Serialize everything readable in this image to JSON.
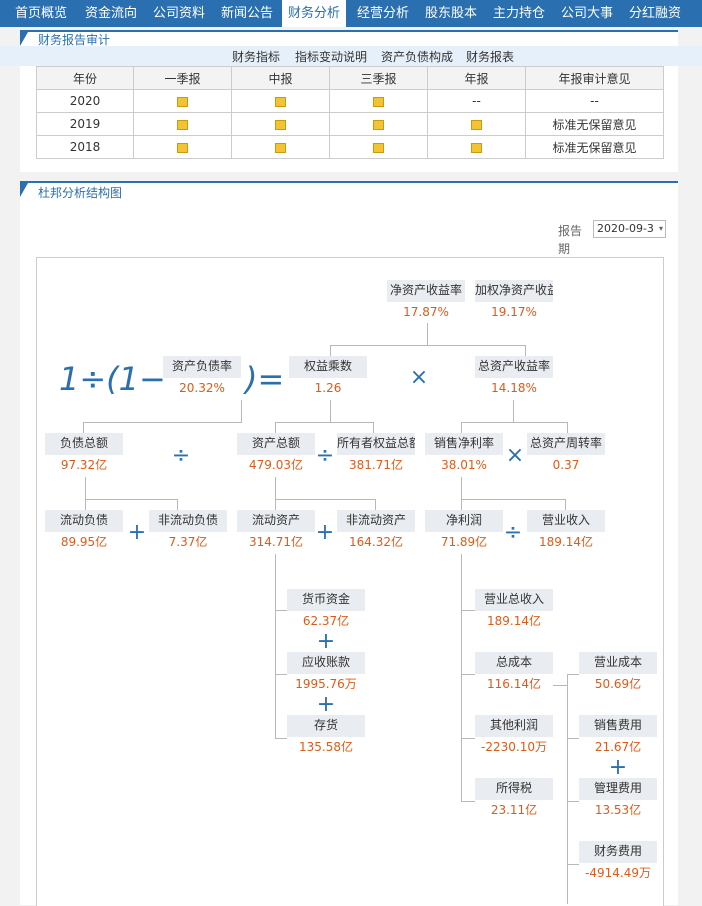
{
  "nav": [
    "首页概览",
    "资金流向",
    "公司资料",
    "新闻公告",
    "财务分析",
    "经营分析",
    "股东股本",
    "主力持仓",
    "公司大事",
    "分红融资"
  ],
  "report_section": {
    "title": "财务报告审计",
    "tabs": [
      "财务指标",
      "指标变动说明",
      "资产负债构成",
      "财务报表"
    ],
    "columns": [
      "年份",
      "一季报",
      "中报",
      "三季报",
      "年报",
      "年报审计意见"
    ],
    "rows": [
      {
        "year": "2020",
        "annual": "--",
        "opinion": "--"
      },
      {
        "year": "2019",
        "annual": "doc",
        "opinion": "标准无保留意见"
      },
      {
        "year": "2018",
        "annual": "doc",
        "opinion": "标准无保留意见"
      }
    ]
  },
  "dupont": {
    "title": "杜邦分析结构图",
    "period_label": "报告期",
    "period_value": "2020-09-3",
    "formula_prefix_a": "1÷(1−",
    "formula_suffix": ")=",
    "nodes": {
      "roe": {
        "t": "净资产收益率",
        "v": "17.87%"
      },
      "wroe": {
        "t": "加权净资产收益率",
        "v": "19.17%"
      },
      "debt_ratio": {
        "t": "资产负债率",
        "v": "20.32%"
      },
      "equity_mult": {
        "t": "权益乘数",
        "v": "1.26"
      },
      "roa": {
        "t": "总资产收益率",
        "v": "14.18%"
      },
      "total_liab": {
        "t": "负债总额",
        "v": "97.32亿"
      },
      "total_assets": {
        "t": "资产总额",
        "v": "479.03亿"
      },
      "owner_equity": {
        "t": "所有者权益总额",
        "v": "381.71亿"
      },
      "net_margin": {
        "t": "销售净利率",
        "v": "38.01%"
      },
      "asset_turn": {
        "t": "总资产周转率",
        "v": "0.37"
      },
      "cur_liab": {
        "t": "流动负债",
        "v": "89.95亿"
      },
      "noncur_liab": {
        "t": "非流动负债",
        "v": "7.37亿"
      },
      "cur_assets": {
        "t": "流动资产",
        "v": "314.71亿"
      },
      "noncur_assets": {
        "t": "非流动资产",
        "v": "164.32亿"
      },
      "net_profit": {
        "t": "净利润",
        "v": "71.89亿"
      },
      "revenue": {
        "t": "营业收入",
        "v": "189.14亿"
      },
      "cash": {
        "t": "货币资金",
        "v": "62.37亿"
      },
      "receivables": {
        "t": "应收账款",
        "v": "1995.76万"
      },
      "inventory": {
        "t": "存货",
        "v": "135.58亿"
      },
      "total_rev": {
        "t": "营业总收入",
        "v": "189.14亿"
      },
      "total_cost": {
        "t": "总成本",
        "v": "116.14亿"
      },
      "op_cost": {
        "t": "营业成本",
        "v": "50.69亿"
      },
      "other_profit": {
        "t": "其他利润",
        "v": "-2230.10万"
      },
      "sales_exp": {
        "t": "销售费用",
        "v": "21.67亿"
      },
      "income_tax": {
        "t": "所得税",
        "v": "23.11亿"
      },
      "admin_exp": {
        "t": "管理费用",
        "v": "13.53亿"
      },
      "fin_exp": {
        "t": "财务费用",
        "v": "-4914.49万"
      }
    }
  },
  "ops": {
    "plus": "+",
    "minus": "−",
    "div": "÷",
    "times": "×"
  },
  "colors": {
    "accent": "#2a6fb0",
    "value": "#e05a16"
  }
}
